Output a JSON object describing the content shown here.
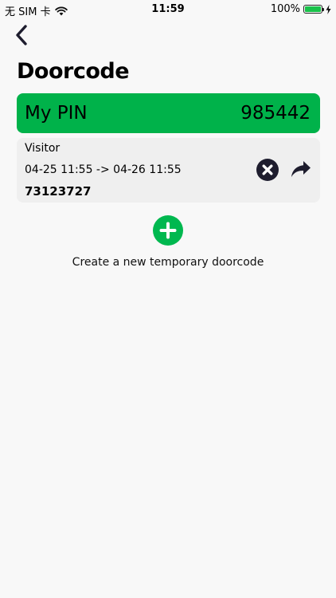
{
  "status_bar": {
    "carrier": "无 SIM 卡",
    "time": "11:59",
    "battery_percent": "100%",
    "battery_level": 1.0,
    "icons": [
      "wifi-icon",
      "battery-icon",
      "charging-bolt-icon"
    ]
  },
  "nav": {
    "back_icon": "chevron-left-icon"
  },
  "page": {
    "title": "Doorcode"
  },
  "pin": {
    "label": "My PIN",
    "code": "985442"
  },
  "temp_codes": [
    {
      "name": "Visitor",
      "validity": "04-25 11:55 -> 04-26 11:55",
      "code": "73123727",
      "actions": [
        "close-circle-icon",
        "share-arrow-icon"
      ]
    }
  ],
  "create": {
    "icon": "plus-circle-icon",
    "label": "Create a new temporary doorcode"
  },
  "colors": {
    "background": "#f8f8f8",
    "pin_card": "#00b24a",
    "add_button": "#00b84f",
    "visitor_card": "#efefef",
    "icon_dark": "#1e1d2e"
  }
}
